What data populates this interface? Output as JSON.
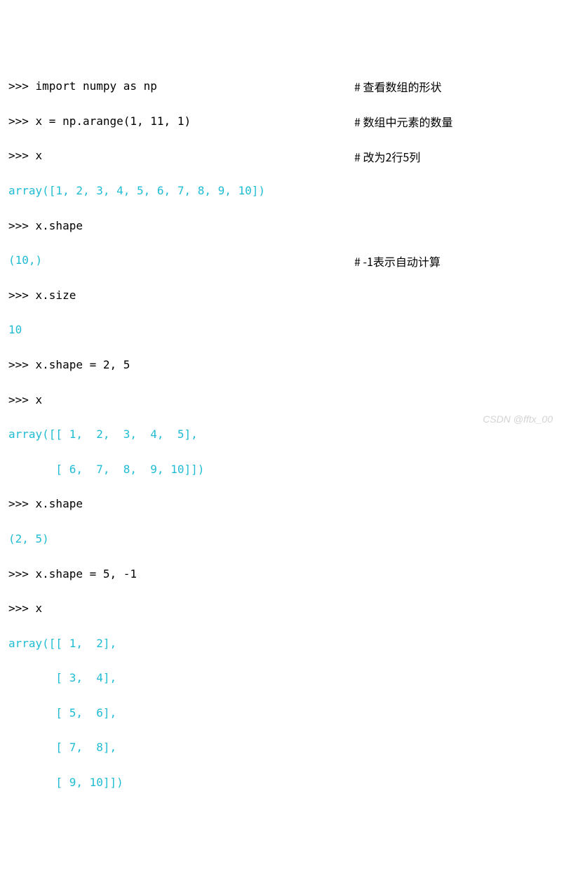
{
  "prompt": ">>> ",
  "lines": {
    "l01": "import numpy as np",
    "l02": "x = np.arange(1, 11, 1)",
    "l03": "x",
    "l04": "array([1, 2, 3, 4, 5, 6, 7, 8, 9, 10])",
    "l05": "x.shape",
    "l06": "(10,)",
    "l07": "x.size",
    "l08": "10",
    "l09": "x.shape = 2, 5",
    "l10": "x",
    "l11": "array([[ 1,  2,  3,  4,  5],",
    "l12": "       [ 6,  7,  8,  9, 10]])",
    "l13": "x.shape",
    "l14": "(2, 5)",
    "l15": "x.shape = 5, -1",
    "l16": "x",
    "l17": "array([[ 1,  2],",
    "l18": "       [ 3,  4],",
    "l19": "       [ 5,  6],",
    "l20": "       [ 7,  8],",
    "l21": "       [ 9, 10]])"
  },
  "comments": {
    "c1": "# 查看数组的形状",
    "c2": "# 数组中元素的数量",
    "c3": "# 改为2行5列",
    "c4": "# -1表示自动计算"
  },
  "watermark": "CSDN @fftx_00",
  "chart_data": {
    "type": "table",
    "description": "Python REPL session demonstrating numpy array shape manipulation",
    "arrays": {
      "initial_1d": [
        1,
        2,
        3,
        4,
        5,
        6,
        7,
        8,
        9,
        10
      ],
      "reshaped_2x5": [
        [
          1,
          2,
          3,
          4,
          5
        ],
        [
          6,
          7,
          8,
          9,
          10
        ]
      ],
      "reshaped_5x2": [
        [
          1,
          2
        ],
        [
          3,
          4
        ],
        [
          5,
          6
        ],
        [
          7,
          8
        ],
        [
          9,
          10
        ]
      ]
    },
    "scalars": {
      "shape_1d": "(10,)",
      "size": 10,
      "shape_2x5": "(2, 5)"
    }
  }
}
